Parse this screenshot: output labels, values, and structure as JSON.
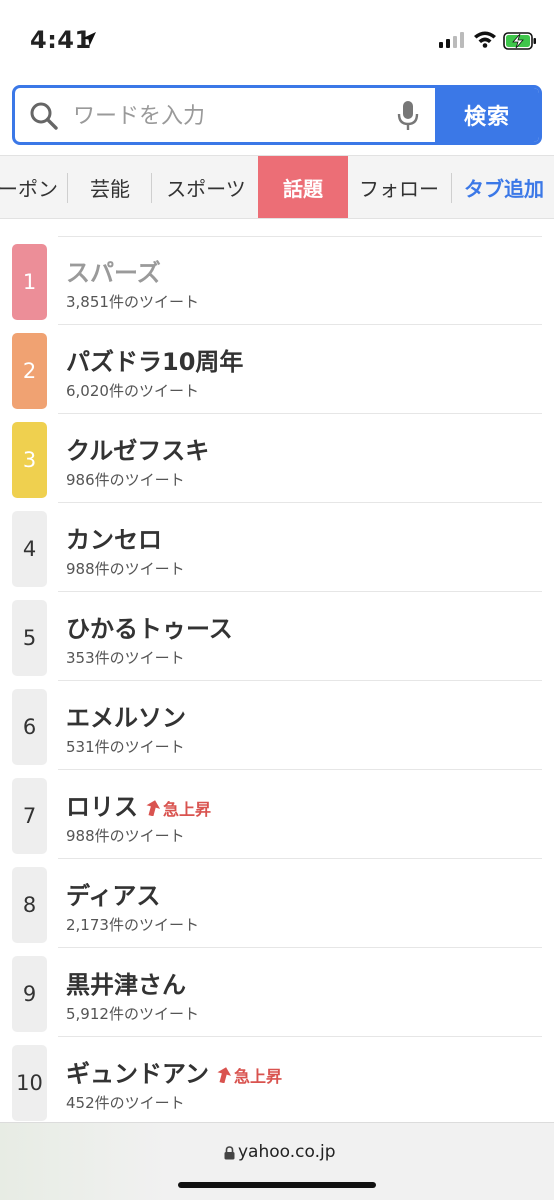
{
  "status": {
    "time": "4:41"
  },
  "search": {
    "placeholder": "ワードを入力",
    "button_label": "検索"
  },
  "tabs": [
    {
      "label": "ーポン"
    },
    {
      "label": "芸能"
    },
    {
      "label": "スポーツ"
    },
    {
      "label": "話題",
      "active": true
    },
    {
      "label": "フォロー"
    },
    {
      "label": "タブ追加"
    }
  ],
  "ranking": [
    {
      "rank": "1",
      "title": "スパーズ",
      "count": "3,851件のツイート"
    },
    {
      "rank": "2",
      "title": "パズドラ10周年",
      "count": "6,020件のツイート"
    },
    {
      "rank": "3",
      "title": "クルゼフスキ",
      "count": "986件のツイート"
    },
    {
      "rank": "4",
      "title": "カンセロ",
      "count": "988件のツイート"
    },
    {
      "rank": "5",
      "title": "ひかるトゥース",
      "count": "353件のツイート"
    },
    {
      "rank": "6",
      "title": "エメルソン",
      "count": "531件のツイート"
    },
    {
      "rank": "7",
      "title": "ロリス",
      "count": "988件のツイート",
      "badge": "急上昇"
    },
    {
      "rank": "8",
      "title": "ディアス",
      "count": "2,173件のツイート"
    },
    {
      "rank": "9",
      "title": "黒井津さん",
      "count": "5,912件のツイート"
    },
    {
      "rank": "10",
      "title": "ギュンドアン",
      "count": "452件のツイート",
      "badge": "急上昇"
    }
  ],
  "browser": {
    "url": "yahoo.co.jp"
  },
  "colors": {
    "accent": "#3b78e7",
    "active_tab": "#ec6e76",
    "rank1": "#ec8e98",
    "rank2": "#f0a272",
    "rank3": "#efd04f",
    "rising": "#d9534f"
  }
}
